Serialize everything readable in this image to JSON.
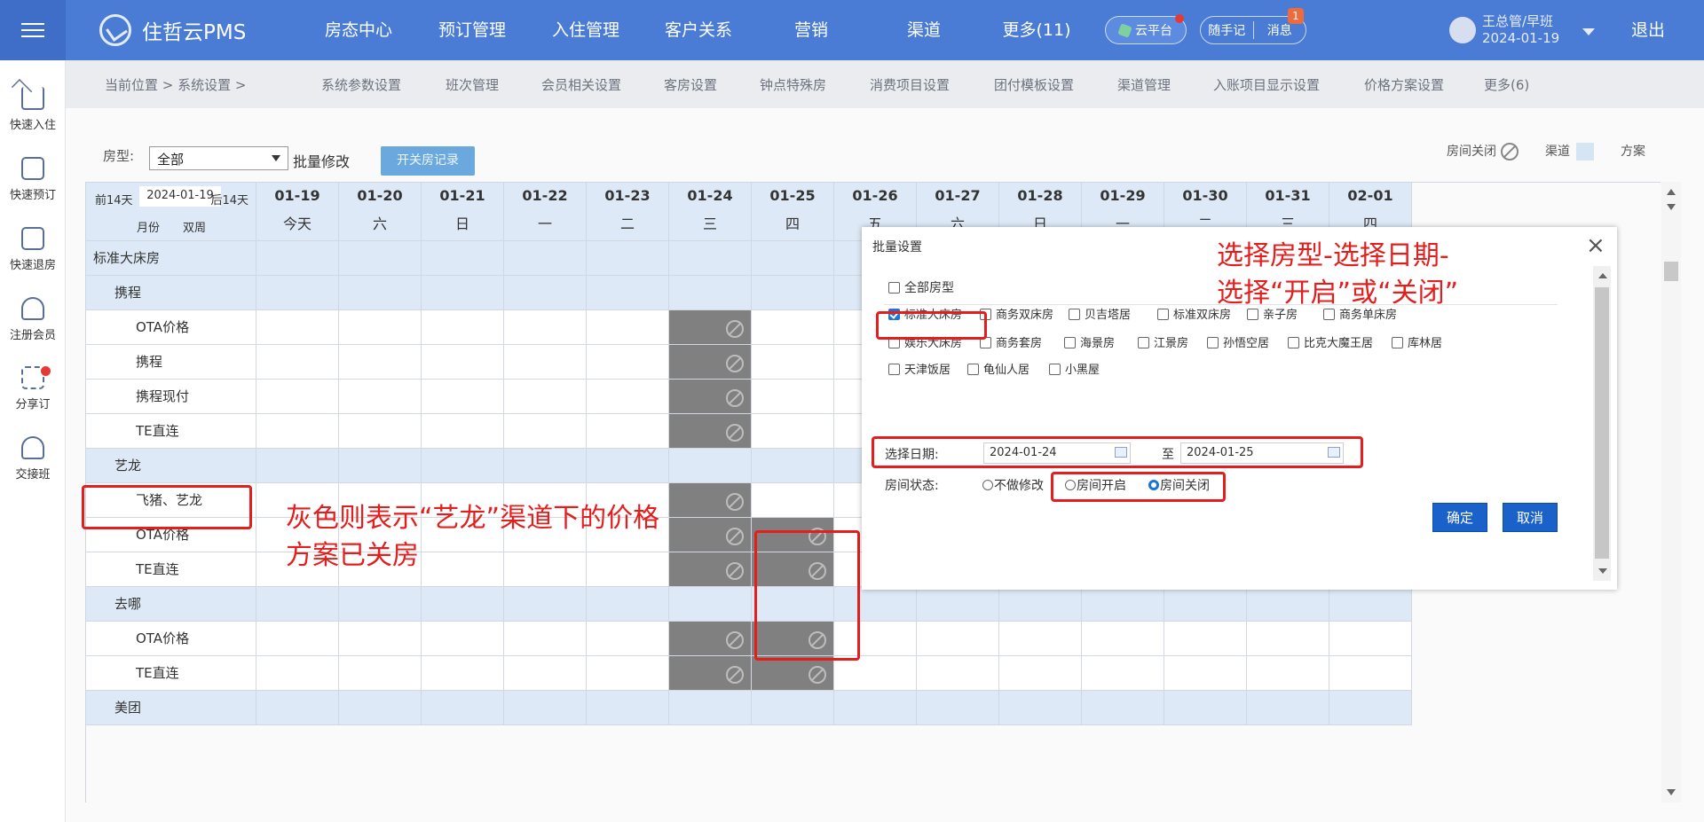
{
  "app": {
    "logo": "住哲云PMS",
    "menu": [
      "房态中心",
      "预订管理",
      "入住管理",
      "客户关系",
      "营销",
      "渠道",
      "更多(11)"
    ],
    "cloud": "云平台",
    "note": "随手记",
    "msg": "消息",
    "msg_count": "1",
    "user": "王总管/早班",
    "date": "2024-01-19",
    "logout": "退出"
  },
  "sidebar": [
    "快速入住",
    "快速预订",
    "快速退房",
    "注册会员",
    "分享订",
    "交接班"
  ],
  "crumb": {
    "location": "当前位置  >  系统设置  >",
    "tabs": [
      "系统参数设置",
      "班次管理",
      "会员相关设置",
      "客房设置",
      "钟点特殊房",
      "消费项目设置",
      "团付模板设置",
      "渠道管理",
      "入账项目显示设置",
      "价格方案设置",
      "更多(6)"
    ]
  },
  "toolbar": {
    "label": "房型:",
    "selected": "全部",
    "batch": "批量修改",
    "record": "开关房记录"
  },
  "legend": {
    "closed": "房间关闭",
    "channel": "渠道",
    "plan": "方案"
  },
  "grid": {
    "prev": "前14天",
    "current_date": "2024-01-19",
    "next": "后14天",
    "month": "月份",
    "week": "双周",
    "dates": [
      "01-19",
      "01-20",
      "01-21",
      "01-22",
      "01-23",
      "01-24",
      "01-25",
      "01-26",
      "01-27",
      "01-28",
      "01-29",
      "01-30",
      "01-31",
      "02-01"
    ],
    "weekdays": [
      "今天",
      "六",
      "日",
      "一",
      "二",
      "三",
      "四",
      "五",
      "六",
      "日",
      "一",
      "二",
      "三",
      "四"
    ],
    "rows": [
      "标准大床房",
      "携程",
      "OTA价格",
      "携程",
      "携程现付",
      "TE直连",
      "艺龙",
      "飞猪、艺龙",
      "OTA价格",
      "TE直连",
      "去哪",
      "OTA价格",
      "TE直连",
      "美团"
    ]
  },
  "modal": {
    "title": "批量设置",
    "all": "全部房型",
    "types": [
      "标准大床房",
      "商务双床房",
      "贝吉塔居",
      "标准双床房",
      "亲子房",
      "商务单床房",
      "娱乐大床房",
      "商务套房",
      "海景房",
      "江景房",
      "孙悟空居",
      "比克大魔王居",
      "库林居",
      "天津饭居",
      "龟仙人居",
      "小黑屋"
    ],
    "date_label": "选择日期:",
    "start": "2024-01-24",
    "to": "至",
    "end": "2024-01-25",
    "status_label": "房间状态:",
    "radios": [
      "不做修改",
      "房间开启",
      "房间关闭"
    ],
    "ok": "确定",
    "cancel": "取消"
  },
  "annotations": {
    "modal_note_1": "选择房型-选择日期-",
    "modal_note_2": "选择“开启”或“关闭”",
    "grey_note_1": "灰色则表示“艺龙”渠道下的价格",
    "grey_note_2": "方案已关房"
  }
}
